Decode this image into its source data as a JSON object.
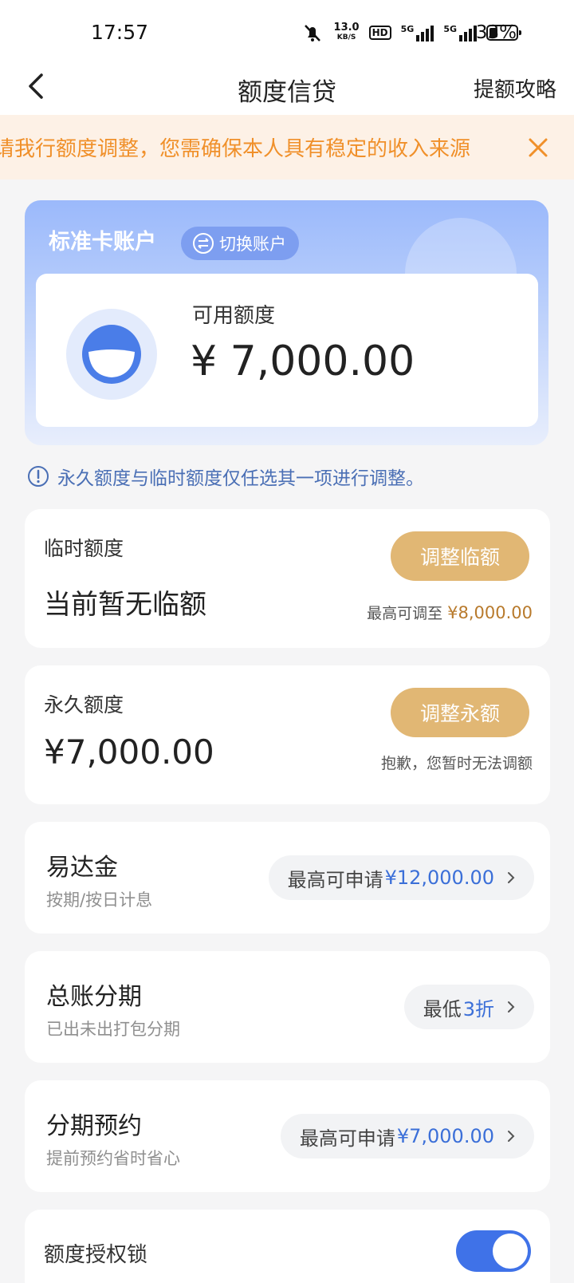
{
  "status_bar": {
    "time": "17:57",
    "net_speed_value": "13.0",
    "net_speed_unit": "KB/S",
    "hd_label": "HD",
    "signal1_label": "5G",
    "signal2_label": "5G",
    "battery_percent": "33%",
    "icons": [
      "mute-bell-icon",
      "hd-icon",
      "signal-icon",
      "signal-icon",
      "battery-icon"
    ]
  },
  "nav": {
    "title": "额度信贷",
    "action": "提额攻略",
    "back_icon": "chevron-left-icon"
  },
  "notice": {
    "text": "请我行额度调整，您需确保本人具有稳定的收入来源",
    "close_icon": "close-icon"
  },
  "account": {
    "name": "标准卡账户",
    "switch_label": "切换账户",
    "available_label": "可用额度",
    "available_value": "¥ 7,000.00"
  },
  "tip": {
    "text": "永久额度与临时额度仅任选其一项进行调整。"
  },
  "temp_limit": {
    "label": "临时额度",
    "status": "当前暂无临额",
    "button": "调整临额",
    "note_prefix": "最高可调至 ",
    "note_value": "¥8,000.00"
  },
  "perm_limit": {
    "label": "永久额度",
    "value": "¥7,000.00",
    "button": "调整永额",
    "note": "抱歉，您暂时无法调额"
  },
  "services": [
    {
      "title": "易达金",
      "subtitle": "按期/按日计息",
      "pill_prefix": "最高可申请 ",
      "pill_highlight": "¥12,000.00",
      "pill_suffix": ""
    },
    {
      "title": "总账分期",
      "subtitle": "已出未出打包分期",
      "pill_prefix": "最低",
      "pill_highlight": "3折",
      "pill_suffix": ""
    },
    {
      "title": "分期预约",
      "subtitle": "提前预约省时省心",
      "pill_prefix": "最高可申请 ",
      "pill_highlight": "¥7,000.00",
      "pill_suffix": ""
    }
  ],
  "lock": {
    "label": "额度授权锁",
    "enabled": true
  },
  "colors": {
    "accent_blue": "#3f72e8",
    "gold_button": "#e1b774",
    "notice_text": "#f0902a",
    "notice_bg": "#fdf1e6"
  }
}
